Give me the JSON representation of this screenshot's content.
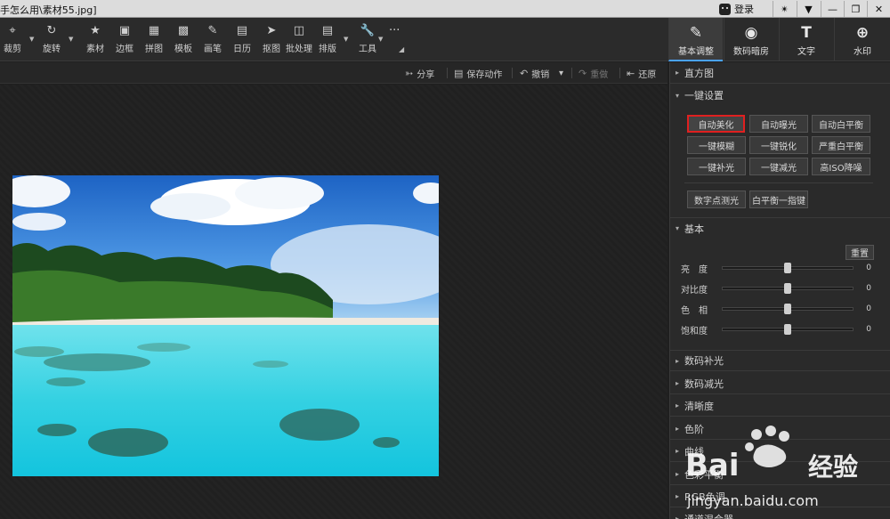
{
  "window": {
    "title": "手怎么用\\素材55.jpg]",
    "login": "登录"
  },
  "toolbar": {
    "tools": [
      {
        "label": "裁剪",
        "icon": "crop-icon"
      },
      {
        "label": "旋转",
        "icon": "rotate-icon"
      },
      {
        "label": "素材",
        "icon": "star-icon"
      },
      {
        "label": "边框",
        "icon": "frame-icon"
      },
      {
        "label": "拼图",
        "icon": "grid-icon"
      },
      {
        "label": "模板",
        "icon": "template-icon"
      },
      {
        "label": "画笔",
        "icon": "brush-icon"
      },
      {
        "label": "日历",
        "icon": "calendar-icon"
      },
      {
        "label": "抠图",
        "icon": "pin-icon"
      },
      {
        "label": "批处理",
        "icon": "batch-icon"
      },
      {
        "label": "排版",
        "icon": "layout-icon"
      },
      {
        "label": "工具",
        "icon": "wrench-icon"
      }
    ],
    "more": "···",
    "right_tabs": [
      {
        "label": "基本调整",
        "icon": "edit-icon",
        "active": true
      },
      {
        "label": "数码暗房",
        "icon": "camera-icon",
        "active": false
      },
      {
        "label": "文字",
        "icon": "text-icon",
        "glyph": "T",
        "active": false
      },
      {
        "label": "水印",
        "icon": "watermark-icon",
        "active": false
      }
    ]
  },
  "actions": {
    "share": "分享",
    "save_action": "保存动作",
    "undo": "撤销",
    "redo": "重做",
    "restore": "还原"
  },
  "panel": {
    "histogram": "直方图",
    "one_click": "一键设置",
    "one_click_buttons": [
      "自动美化",
      "自动曝光",
      "自动白平衡",
      "一键模糊",
      "一键锐化",
      "严重白平衡",
      "一键补光",
      "一键减光",
      "高ISO降噪"
    ],
    "extra_buttons": [
      "数字点测光",
      "白平衡一指键"
    ],
    "basic": "基本",
    "reset": "重置",
    "sliders": [
      {
        "name": "亮　度",
        "value": "0",
        "level": 0.5
      },
      {
        "name": "对比度",
        "value": "0",
        "level": 0.5
      },
      {
        "name": "色　相",
        "value": "0",
        "level": 0.5
      },
      {
        "name": "饱和度",
        "value": "0",
        "level": 0.5
      }
    ],
    "sections": [
      "数码补光",
      "数码减光",
      "清晰度",
      "色阶",
      "曲线",
      "色彩平衡",
      "RGB色调",
      "通道混合器"
    ]
  },
  "watermark": {
    "brand_latin": "Bai",
    "brand_cn": "经验",
    "url": "jingyan.baidu.com"
  },
  "colors": {
    "accent": "#4aa3ff",
    "highlight": "#e02020"
  }
}
